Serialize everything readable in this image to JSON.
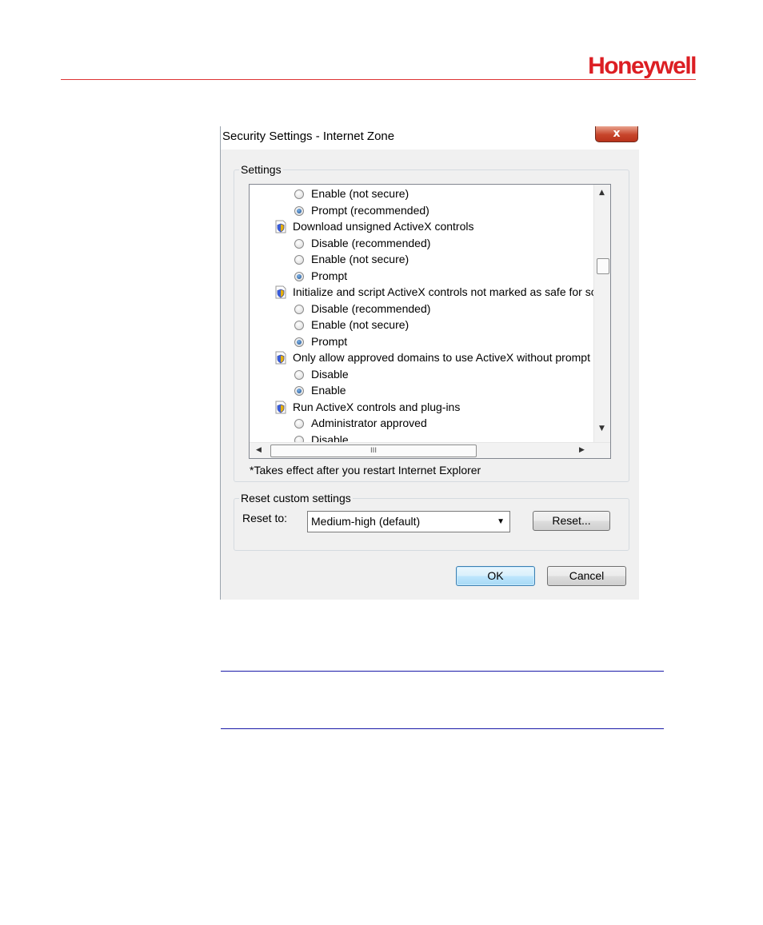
{
  "header": {
    "brand": "Honeywell",
    "brand_color": "#dc1e23"
  },
  "dialog": {
    "title": "Security Settings - Internet Zone",
    "close_label": "x",
    "settings": {
      "legend": "Settings",
      "items": [
        {
          "kind": "option",
          "label": "Enable (not secure)",
          "checked": false
        },
        {
          "kind": "option",
          "label": "Prompt (recommended)",
          "checked": true
        },
        {
          "kind": "header",
          "label": "Download unsigned ActiveX controls"
        },
        {
          "kind": "option",
          "label": "Disable (recommended)",
          "checked": false
        },
        {
          "kind": "option",
          "label": "Enable (not secure)",
          "checked": false
        },
        {
          "kind": "option",
          "label": "Prompt",
          "checked": true
        },
        {
          "kind": "header",
          "label": "Initialize and script ActiveX controls not marked as safe for sc"
        },
        {
          "kind": "option",
          "label": "Disable (recommended)",
          "checked": false
        },
        {
          "kind": "option",
          "label": "Enable (not secure)",
          "checked": false
        },
        {
          "kind": "option",
          "label": "Prompt",
          "checked": true
        },
        {
          "kind": "header",
          "label": "Only allow approved domains to use ActiveX without prompt"
        },
        {
          "kind": "option",
          "label": "Disable",
          "checked": false
        },
        {
          "kind": "option",
          "label": "Enable",
          "checked": true
        },
        {
          "kind": "header",
          "label": "Run ActiveX controls and plug-ins"
        },
        {
          "kind": "option",
          "label": "Administrator approved",
          "checked": false
        },
        {
          "kind": "option",
          "label": "Disable",
          "checked": false
        }
      ],
      "hscroll_grip": "III",
      "note": "*Takes effect after you restart Internet Explorer"
    },
    "reset": {
      "legend": "Reset custom settings",
      "reset_to_label": "Reset to:",
      "selected": "Medium-high (default)",
      "reset_button": "Reset..."
    },
    "ok_label": "OK",
    "cancel_label": "Cancel"
  }
}
